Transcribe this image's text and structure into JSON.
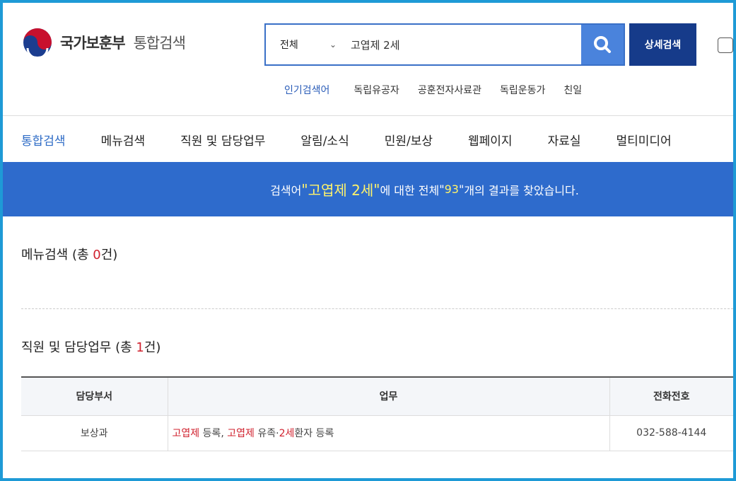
{
  "header": {
    "org_name": "국가보훈부",
    "service_name": "통합검색",
    "search": {
      "scope": "전체",
      "query": "고엽제 2세"
    },
    "detail_search_label": "상세검색",
    "popular": {
      "label": "인기검색어",
      "keywords": [
        "독립유공자",
        "공훈전자사료관",
        "독립운동가",
        "친일"
      ]
    }
  },
  "nav": {
    "tabs": [
      "통합검색",
      "메뉴검색",
      "직원 및 담당업무",
      "알림/소식",
      "민원/보상",
      "웹페이지",
      "자료실",
      "멀티미디어"
    ],
    "active": "통합검색"
  },
  "banner": {
    "prefix": "검색어 ",
    "q_open": "\"",
    "query": "고엽제 2세",
    "q_close": "\"",
    "middle": "에 대한 전체 ",
    "n_open": "\"",
    "count": "93",
    "n_close": "\"",
    "suffix": "개의 결과를 찾았습니다."
  },
  "sections": {
    "menu": {
      "title": "메뉴검색",
      "open": " (총 ",
      "count": "0",
      "close": "건)"
    },
    "staff": {
      "title": "직원 및 담당업무",
      "open": " (총 ",
      "count": "1",
      "close": "건)"
    }
  },
  "staff_table": {
    "headers": [
      "담당부서",
      "업무",
      "전화전호"
    ],
    "rows": [
      {
        "dept": "보상과",
        "task_parts": [
          {
            "text": "고엽제",
            "hl": true
          },
          {
            "text": " 등록, ",
            "hl": false
          },
          {
            "text": "고엽제",
            "hl": true
          },
          {
            "text": " 유족·",
            "hl": false
          },
          {
            "text": "2세",
            "hl": true
          },
          {
            "text": "환자 등록",
            "hl": false
          }
        ],
        "phone": "032-588-4144"
      }
    ]
  },
  "colors": {
    "accent": "#2e6bcc",
    "brand_dark": "#163b8a",
    "highlight_text": "#fff36b",
    "count_red": "#d0212e"
  }
}
